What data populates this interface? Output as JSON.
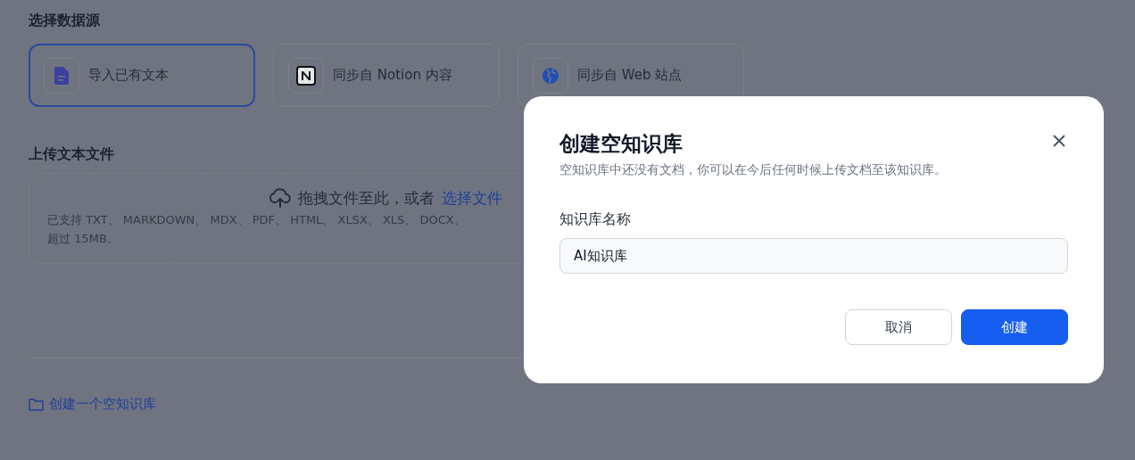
{
  "data_source": {
    "title": "选择数据源",
    "options": [
      {
        "kind": "file",
        "label": "导入已有文本",
        "selected": true
      },
      {
        "kind": "notion",
        "label": "同步自 Notion 内容",
        "selected": false
      },
      {
        "kind": "web",
        "label": "同步自 Web 站点",
        "selected": false
      }
    ]
  },
  "upload": {
    "title": "上传文本文件",
    "drop_text": "拖拽文件至此，或者",
    "link": "选择文件",
    "support_lines": [
      "已支持 TXT、 MARKDOWN、 MDX、 PDF、 HTML、 XLSX、 XLS、 DOCX、",
      "超过 15MB。"
    ]
  },
  "create_empty_link": "创建一个空知识库",
  "dialog": {
    "title": "创建空知识库",
    "description": "空知识库中还没有文档，你可以在今后任何时候上传文档至该知识库。",
    "field_label": "知识库名称",
    "field_value": "AI知识库",
    "buttons": [
      {
        "kind": "secondary",
        "label": "取消"
      },
      {
        "kind": "primary",
        "label": "创建"
      }
    ]
  }
}
